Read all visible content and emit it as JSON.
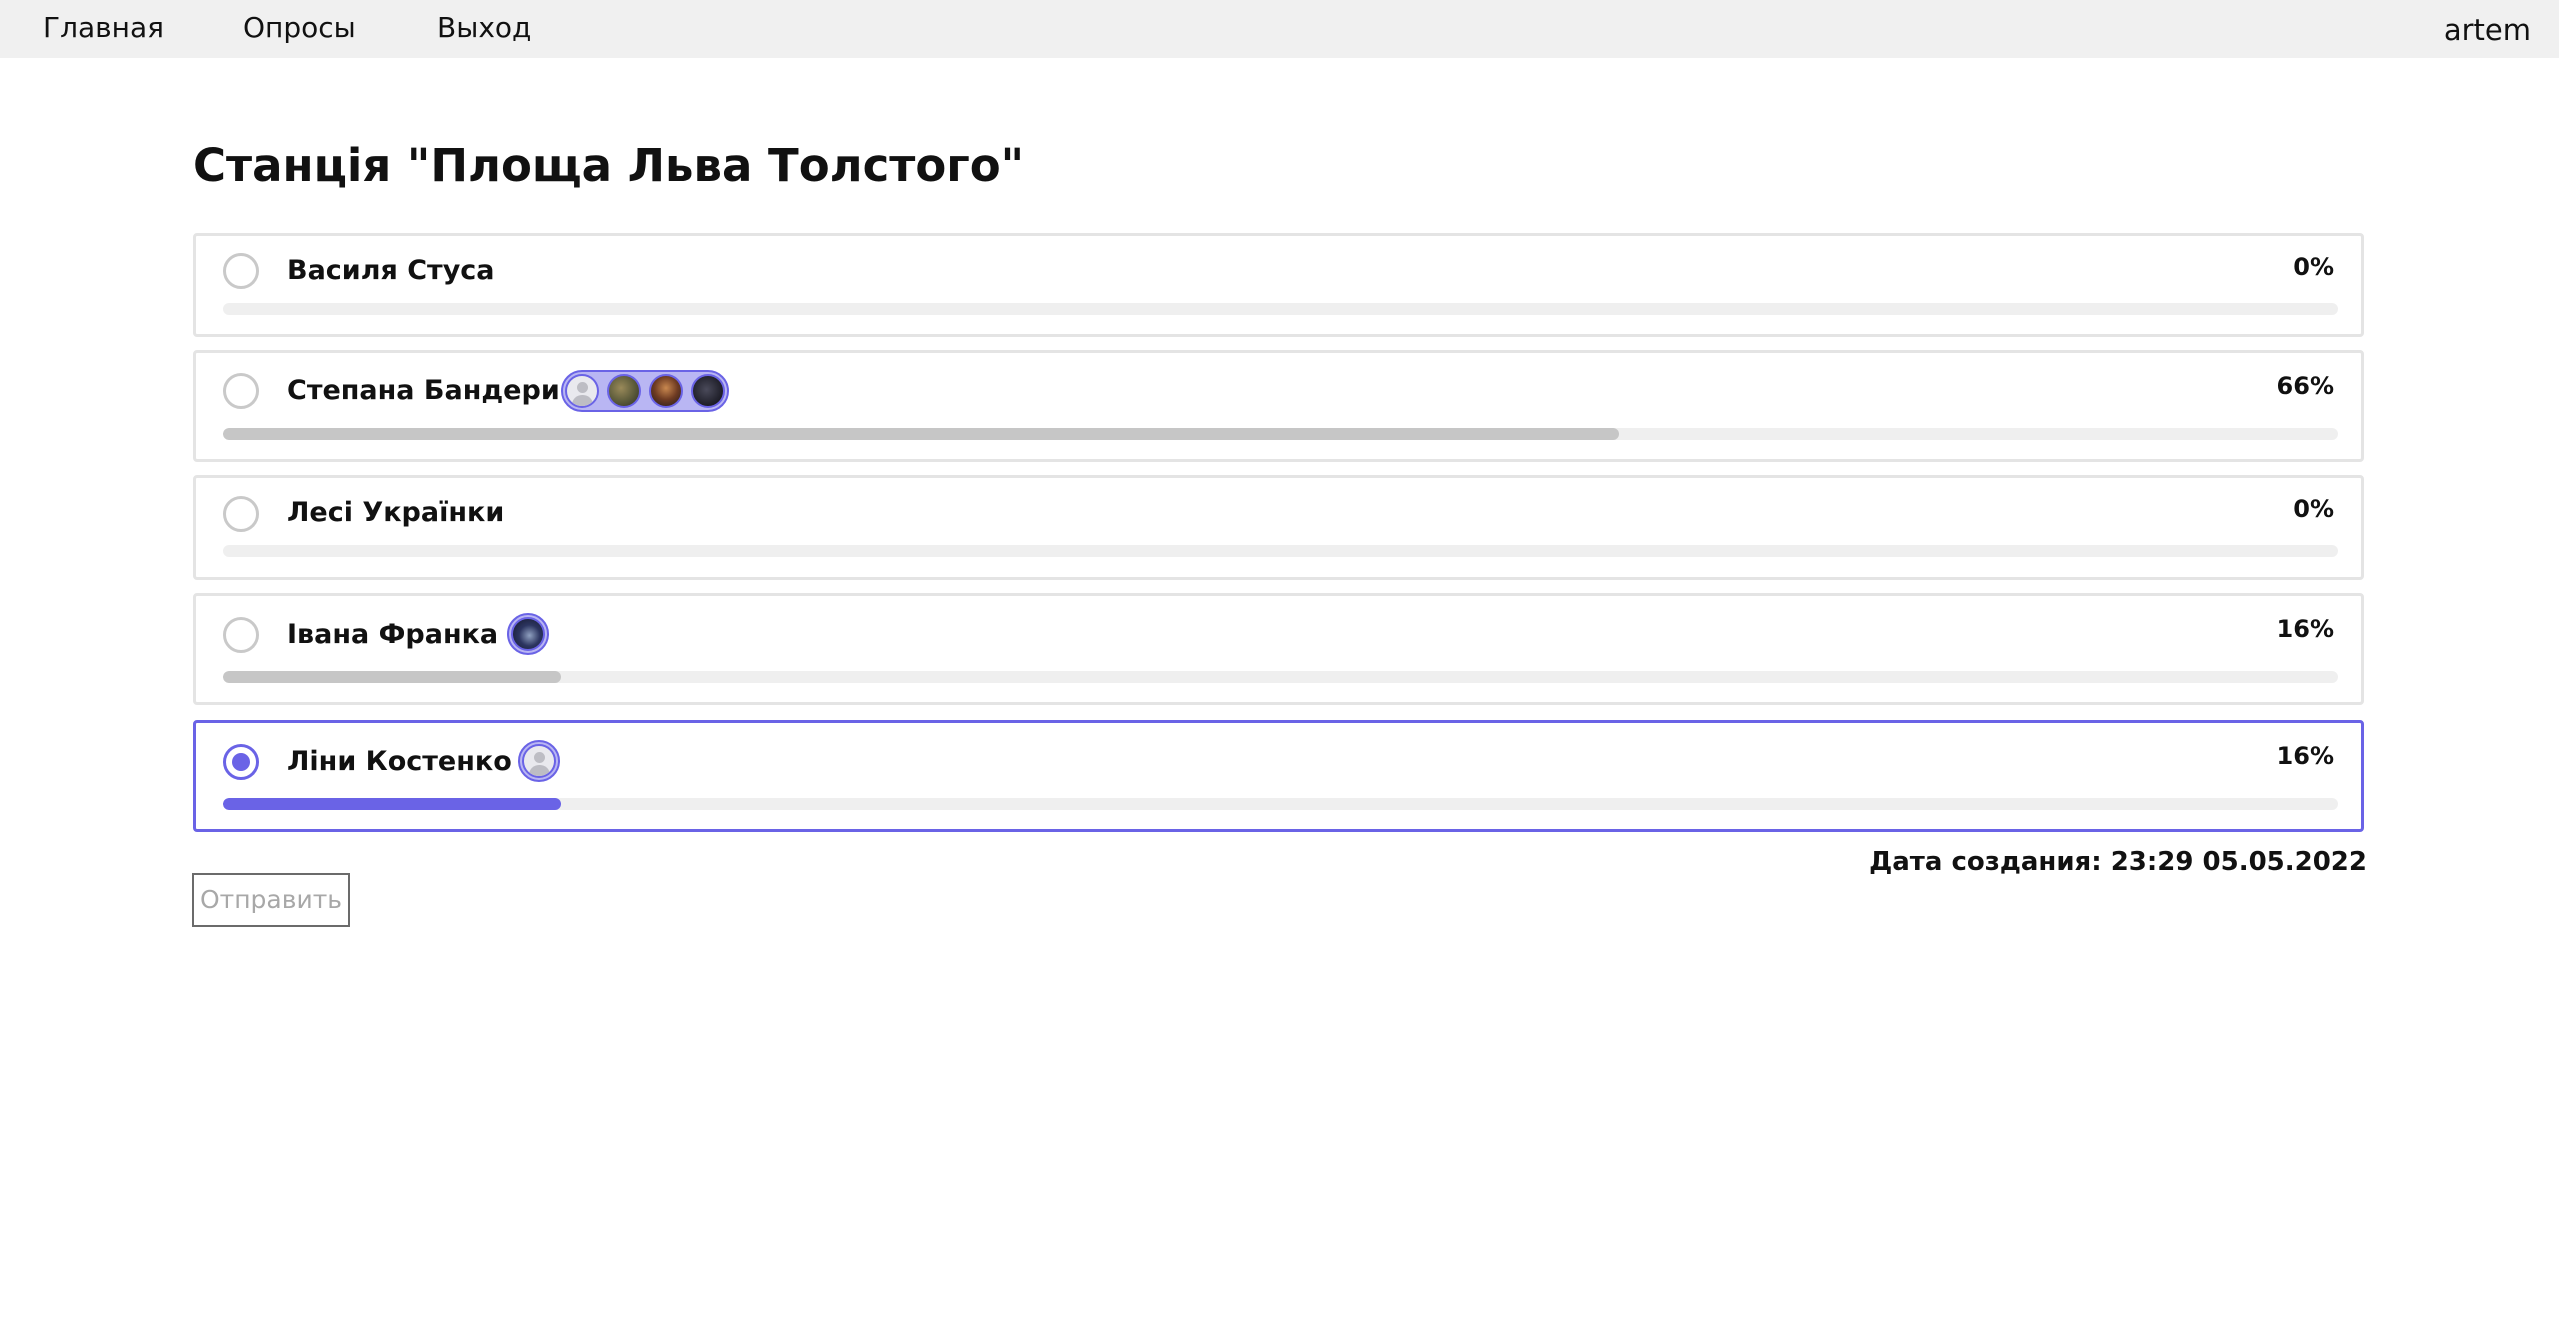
{
  "nav": {
    "home": "Главная",
    "polls": "Опросы",
    "logout": "Выход",
    "username": "artem"
  },
  "poll": {
    "title": "Станція \"Площа Льва Толстого\"",
    "options": [
      {
        "label": "Василя Стуса",
        "percent_text": "0%",
        "percent": 0,
        "selected": false,
        "voter_avatars": []
      },
      {
        "label": "Степана Бандери",
        "percent_text": "66%",
        "percent": 66,
        "selected": false,
        "voter_avatars": [
          "avatar-placeholder",
          "avatar-photo",
          "avatar-photo",
          "avatar-photo"
        ]
      },
      {
        "label": "Лесі Українки",
        "percent_text": "0%",
        "percent": 0,
        "selected": false,
        "voter_avatars": []
      },
      {
        "label": "Івана Франка",
        "percent_text": "16%",
        "percent": 16,
        "selected": false,
        "voter_avatars": [
          "avatar-photo"
        ]
      },
      {
        "label": "Ліни Костенко",
        "percent_text": "16%",
        "percent": 16,
        "selected": true,
        "voter_avatars": [
          "avatar-placeholder"
        ]
      }
    ],
    "created_label": "Дата создания: 23:29 05.05.2022",
    "submit_label": "Отправить"
  },
  "colors": {
    "accent": "#6a63e6",
    "bar_fill": "#c6c6c6",
    "bar_track": "#efefef",
    "topbar_bg": "#f0f0f0"
  }
}
